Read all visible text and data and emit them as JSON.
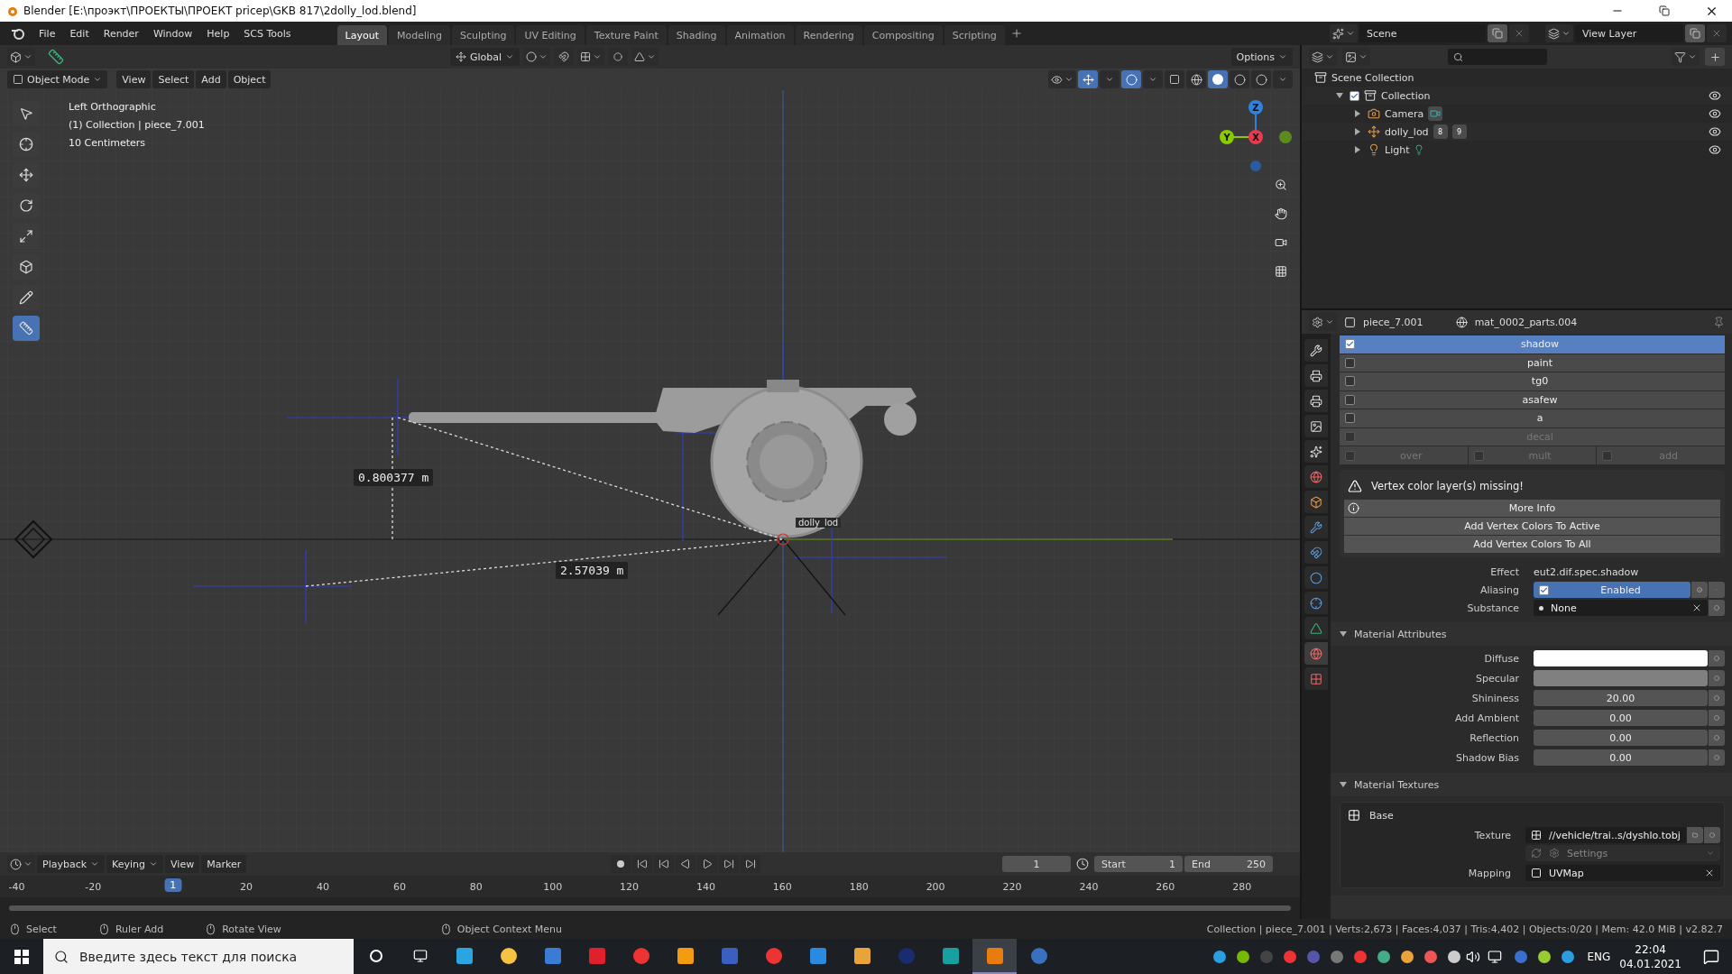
{
  "window": {
    "title": "Blender [E:\\проэкт\\ПРОЕКТЫ\\ПРОЕКТ pricep\\GKB 817\\2dolly_lod.blend]"
  },
  "menu": [
    "File",
    "Edit",
    "Render",
    "Window",
    "Help",
    "SCS Tools"
  ],
  "workspaces": [
    {
      "label": "Layout",
      "selected": true
    },
    {
      "label": "Modeling",
      "selected": false
    },
    {
      "label": "Sculpting",
      "selected": false
    },
    {
      "label": "UV Editing",
      "selected": false
    },
    {
      "label": "Texture Paint",
      "selected": false
    },
    {
      "label": "Shading",
      "selected": false
    },
    {
      "label": "Animation",
      "selected": false
    },
    {
      "label": "Rendering",
      "selected": false
    },
    {
      "label": "Compositing",
      "selected": false
    },
    {
      "label": "Scripting",
      "selected": false
    }
  ],
  "scene": {
    "name": "Scene"
  },
  "view_layer": {
    "name": "View Layer"
  },
  "tool_header": {
    "orientation": "Global",
    "options": "Options"
  },
  "viewport": {
    "mode": "Object Mode",
    "menus": [
      "View",
      "Select",
      "Add",
      "Object"
    ],
    "info": [
      "Left Orthographic",
      "(1) Collection | piece_7.001",
      "10 Centimeters"
    ],
    "measure_vertical": "0.800377 m",
    "measure_diagonal": "2.57039 m",
    "object_name": "dolly_lod",
    "axes": {
      "z": "Z",
      "y": "Y",
      "x": "X"
    },
    "tools": [
      {
        "selected": false
      },
      {
        "selected": false
      },
      {
        "selected": false
      },
      {
        "selected": false
      },
      {
        "selected": false
      },
      {
        "selected": false
      },
      {
        "selected": false
      },
      {
        "selected": true
      }
    ]
  },
  "outliner": {
    "root": "Scene Collection",
    "items": [
      {
        "label": "Collection",
        "kind": "collection",
        "checked": true,
        "expanded": true,
        "children": [
          {
            "label": "Camera",
            "kind": "camera",
            "expanded": false
          },
          {
            "label": "dolly_lod",
            "kind": "empty",
            "expanded": false,
            "badges": [
              "8",
              "9"
            ]
          },
          {
            "label": "Light",
            "kind": "light",
            "expanded": false
          }
        ]
      }
    ]
  },
  "properties": {
    "object": "piece_7.001",
    "material": "mat_0002_parts.004",
    "layers": [
      {
        "label": "shadow",
        "checked": true,
        "selected": true,
        "disabled": false
      },
      {
        "label": "paint",
        "checked": false,
        "selected": false,
        "disabled": false
      },
      {
        "label": "tg0",
        "checked": false,
        "selected": false,
        "disabled": false
      },
      {
        "label": "asafew",
        "checked": false,
        "selected": false,
        "disabled": false
      },
      {
        "label": "a",
        "checked": false,
        "selected": false,
        "disabled": false
      },
      {
        "label": "decal",
        "checked": false,
        "selected": false,
        "disabled": true
      }
    ],
    "blend_modes": [
      {
        "label": "over",
        "checked": false
      },
      {
        "label": "mult",
        "checked": false
      },
      {
        "label": "add",
        "checked": false
      }
    ],
    "warning": "Vertex color layer(s) missing!",
    "actions": [
      "More Info",
      "Add Vertex Colors To Active",
      "Add Vertex Colors To All"
    ],
    "effect": {
      "label": "Effect",
      "value": "eut2.dif.spec.shadow"
    },
    "aliasing": {
      "label": "Aliasing",
      "value": "Enabled",
      "checked": true
    },
    "substance": {
      "label": "Substance",
      "value": "None"
    },
    "attributes": {
      "title": "Material Attributes",
      "expanded": true,
      "rows": [
        {
          "label": "Diffuse",
          "kind": "color",
          "color": "#ffffff"
        },
        {
          "label": "Specular",
          "kind": "color",
          "color": "#808080"
        },
        {
          "label": "Shininess",
          "kind": "number",
          "value": "20.00"
        },
        {
          "label": "Add Ambient",
          "kind": "number",
          "value": "0.00"
        },
        {
          "label": "Reflection",
          "kind": "number",
          "value": "0.00"
        },
        {
          "label": "Shadow Bias",
          "kind": "number",
          "value": "0.00"
        }
      ]
    },
    "textures": {
      "title": "Material Textures",
      "expanded": true,
      "name": "Base",
      "texture": {
        "label": "Texture",
        "value": "//vehicle/trai..s/dyshlo.tobj"
      },
      "settings": "Settings",
      "mapping": {
        "label": "Mapping",
        "value": "UVMap"
      }
    }
  },
  "timeline": {
    "menus": [
      "Playback",
      "Keying",
      "View",
      "Marker"
    ],
    "frame": "1",
    "start": {
      "label": "Start",
      "value": "1"
    },
    "end": {
      "label": "End",
      "value": "250"
    },
    "ticks": [
      "-40",
      "-20",
      "20",
      "40",
      "60",
      "80",
      "100",
      "120",
      "140",
      "160",
      "180",
      "200",
      "220",
      "240",
      "260",
      "280"
    ],
    "playhead": {
      "label": "1",
      "level": 0.133
    }
  },
  "status_bar": {
    "hints": [
      "Select",
      "Ruler Add",
      "Rotate View",
      "Object Context Menu"
    ],
    "stats": "Collection | piece_7.001 | Verts:2,673 | Faces:4,037 | Tris:4,402 | Objects:0/20 | Mem: 42.0 MiB | v2.82.7"
  },
  "taskbar": {
    "search_placeholder": "Введите здесь текст для поиска",
    "apps": [
      {
        "selected": false
      },
      {
        "selected": false
      },
      {
        "selected": false
      },
      {
        "selected": false
      },
      {
        "selected": false
      },
      {
        "selected": false
      },
      {
        "selected": false
      },
      {
        "selected": false
      },
      {
        "selected": false
      },
      {
        "selected": false
      },
      {
        "selected": false
      },
      {
        "selected": false
      },
      {
        "selected": false
      },
      {
        "selected": false
      },
      {
        "selected": true
      },
      {
        "selected": false
      }
    ],
    "language": "ENG",
    "time": "22:04",
    "date": "04.01.2021"
  }
}
